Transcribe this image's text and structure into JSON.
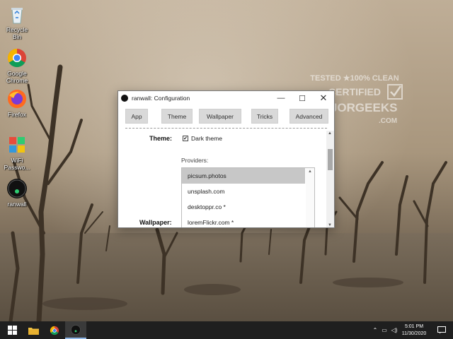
{
  "desktop": {
    "icons": [
      {
        "label": "Recycle Bin",
        "icon": "recycle-bin-icon"
      },
      {
        "label": "Google Chrome",
        "icon": "chrome-icon"
      },
      {
        "label": "Firefox",
        "icon": "firefox-icon"
      },
      {
        "label": "WiFi Passwo...",
        "icon": "wifi-password-icon"
      },
      {
        "label": "ranwall",
        "icon": "ranwall-icon"
      }
    ],
    "watermark": {
      "line1": "TESTED ★100% CLEAN",
      "line2": "CERTIFIED",
      "line3": "MAJORGEEKS",
      "line4": ".COM"
    }
  },
  "window": {
    "title": "ranwall: Configuration",
    "tabs": [
      {
        "label": "App"
      },
      {
        "label": "Theme"
      },
      {
        "label": "Wallpaper"
      },
      {
        "label": "Tricks"
      },
      {
        "label": "Advanced"
      }
    ],
    "theme_label": "Theme:",
    "dark_theme_label": "Dark theme",
    "dark_theme_checked": true,
    "providers_label": "Providers:",
    "providers": [
      {
        "label": "picsum.photos",
        "selected": true
      },
      {
        "label": "unsplash.com",
        "selected": false
      },
      {
        "label": "desktoppr.co *",
        "selected": false
      },
      {
        "label": "loremFlickr.com *",
        "selected": false
      }
    ],
    "wallpaper_label": "Wallpaper:"
  },
  "taskbar": {
    "time": "5:01 PM",
    "date": "11/30/2020"
  },
  "colors": {
    "accent": "#8fb8e8",
    "taskbar": "#1f1f1f",
    "selected_item": "#c7c7c7"
  }
}
